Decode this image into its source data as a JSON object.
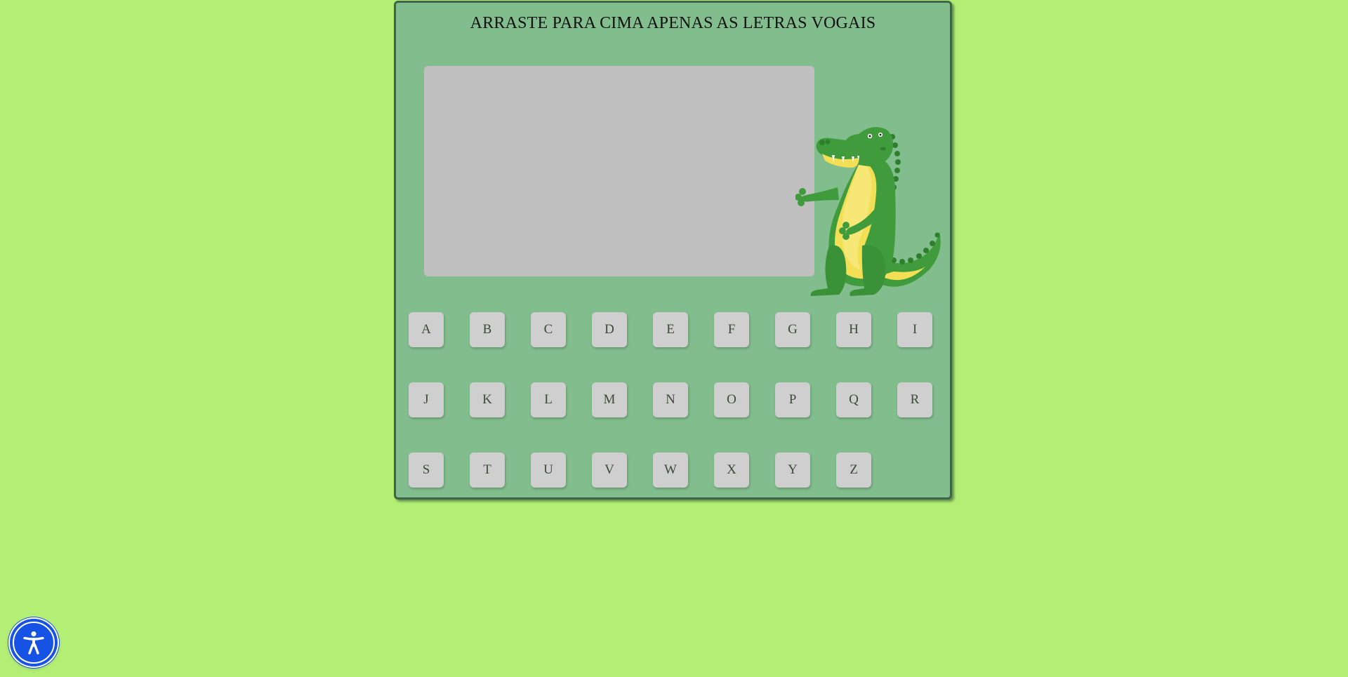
{
  "game": {
    "instruction": "ARRASTE PARA CIMA APENAS AS LETRAS VOGAIS",
    "letters": [
      "A",
      "B",
      "C",
      "D",
      "E",
      "F",
      "G",
      "H",
      "I",
      "J",
      "K",
      "L",
      "M",
      "N",
      "O",
      "P",
      "Q",
      "R",
      "S",
      "T",
      "U",
      "V",
      "W",
      "X",
      "Y",
      "Z"
    ]
  },
  "mascot": {
    "icon": "crocodile-mascot"
  },
  "accessibility": {
    "icon": "accessibility-icon"
  },
  "colors": {
    "page_background": "#b2ef74",
    "panel_background": "#82bd8d",
    "panel_border": "#3e6449",
    "drop_zone": "#c0c0c0",
    "tile": "#cfcfcf",
    "tile_text": "#3d4a3a",
    "accessibility_button": "#1652e3"
  }
}
